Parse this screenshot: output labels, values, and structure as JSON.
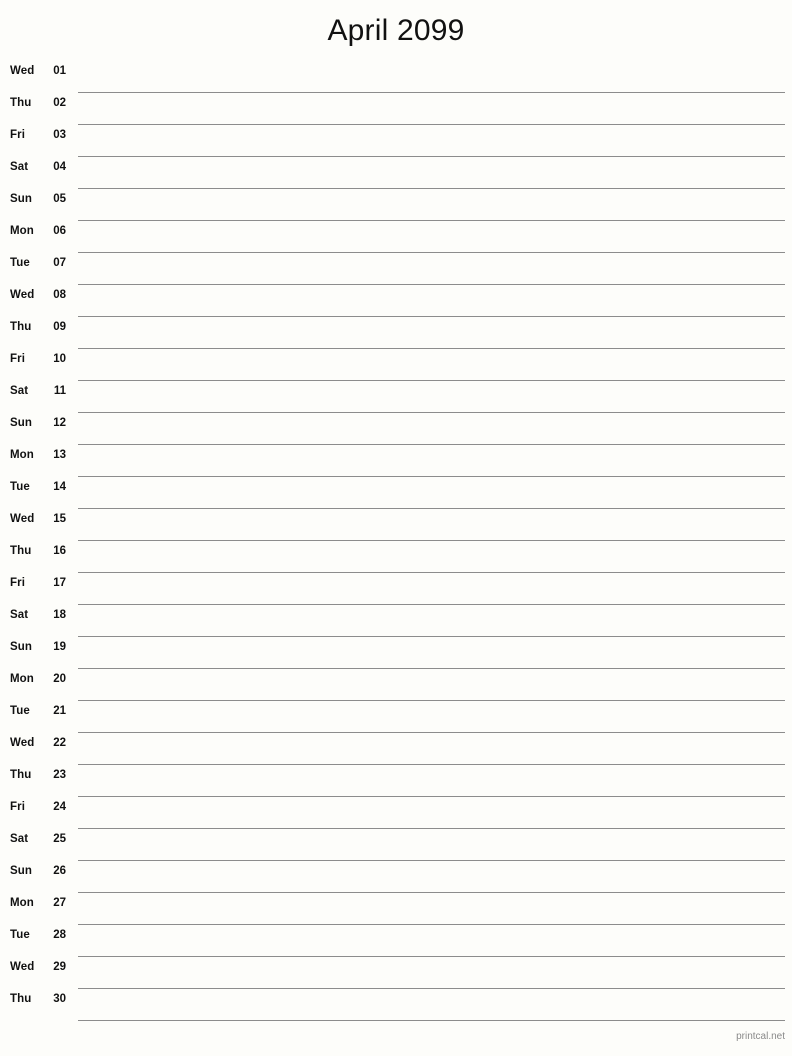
{
  "document": {
    "title": "April 2099",
    "month": "April",
    "year": "2099"
  },
  "calendar": {
    "rows": [
      {
        "dow": "Wed",
        "dom": "01"
      },
      {
        "dow": "Thu",
        "dom": "02"
      },
      {
        "dow": "Fri",
        "dom": "03"
      },
      {
        "dow": "Sat",
        "dom": "04"
      },
      {
        "dow": "Sun",
        "dom": "05"
      },
      {
        "dow": "Mon",
        "dom": "06"
      },
      {
        "dow": "Tue",
        "dom": "07"
      },
      {
        "dow": "Wed",
        "dom": "08"
      },
      {
        "dow": "Thu",
        "dom": "09"
      },
      {
        "dow": "Fri",
        "dom": "10"
      },
      {
        "dow": "Sat",
        "dom": "11"
      },
      {
        "dow": "Sun",
        "dom": "12"
      },
      {
        "dow": "Mon",
        "dom": "13"
      },
      {
        "dow": "Tue",
        "dom": "14"
      },
      {
        "dow": "Wed",
        "dom": "15"
      },
      {
        "dow": "Thu",
        "dom": "16"
      },
      {
        "dow": "Fri",
        "dom": "17"
      },
      {
        "dow": "Sat",
        "dom": "18"
      },
      {
        "dow": "Sun",
        "dom": "19"
      },
      {
        "dow": "Mon",
        "dom": "20"
      },
      {
        "dow": "Tue",
        "dom": "21"
      },
      {
        "dow": "Wed",
        "dom": "22"
      },
      {
        "dow": "Thu",
        "dom": "23"
      },
      {
        "dow": "Fri",
        "dom": "24"
      },
      {
        "dow": "Sat",
        "dom": "25"
      },
      {
        "dow": "Sun",
        "dom": "26"
      },
      {
        "dow": "Mon",
        "dom": "27"
      },
      {
        "dow": "Tue",
        "dom": "28"
      },
      {
        "dow": "Wed",
        "dom": "29"
      },
      {
        "dow": "Thu",
        "dom": "30"
      }
    ]
  },
  "footer": {
    "source": "printcal.net"
  },
  "colors": {
    "background": "#fdfdfa",
    "text": "#111111",
    "rule": "#8c8c8c",
    "footer_text": "#8a8a8a"
  }
}
